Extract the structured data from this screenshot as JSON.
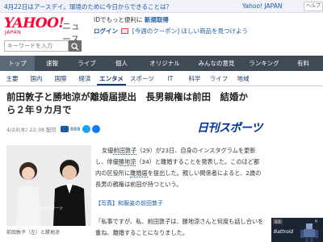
{
  "infobar": {
    "promo": "4月22日はアースデイ。環境のために今日からできることは？",
    "yahoo_japan": "Yahoo! JAPAN",
    "help": "ヘルプ"
  },
  "header": {
    "logo_main": "YAHOO!",
    "logo_sub": "JAPAN",
    "logo_news": "ニュース",
    "promo_line1": "IDでもっと便利に",
    "register": "新規取得",
    "login": "ログイン",
    "coupon": "[今週のクーポン] ほしい商品を見つけよう"
  },
  "search": {
    "placeholder": "キーワードを入力"
  },
  "nav_primary": [
    {
      "label": "トップ",
      "active": true
    },
    {
      "label": "速報"
    },
    {
      "label": "ライブ"
    },
    {
      "label": "個人"
    },
    {
      "label": "オリジナル"
    },
    {
      "label": "みんなの意見"
    },
    {
      "label": "ランキング"
    },
    {
      "label": "有料"
    }
  ],
  "nav_secondary": [
    {
      "label": "主要"
    },
    {
      "label": "国内"
    },
    {
      "label": "国際"
    },
    {
      "label": "経済"
    },
    {
      "label": "エンタメ",
      "active": true
    },
    {
      "label": "スポーツ"
    },
    {
      "label": "IT"
    },
    {
      "label": "科学"
    },
    {
      "label": "ライフ"
    },
    {
      "label": "地域"
    }
  ],
  "article": {
    "title": "前田敦子と勝地涼が離婚届提出　長男親権は前田　結婚から２年９カ月で",
    "date": "4/23(木) 22:38 配信",
    "comment_count": "888",
    "brand": "日刊スポーツ",
    "photo_caption": "前田敦子（左）と勝地涼",
    "photo_watermark": "日刊スポーツ",
    "body_prefix": "女優",
    "body_name1": "前田敦子",
    "body_mid1": "（29）が23日、自身のインスタグラムを更新し、俳優",
    "body_name2": "勝地涼",
    "body_mid2": "（34）と離婚することを発表した。このほど都内の区役所に",
    "body_term": "離婚届",
    "body_suffix": "を提出した。親しい関係者によると、2歳の長男の親権は前田が持つという。",
    "photo_link": "【写真】和服姿の前田敦子",
    "quote": "「私事ですが、私、前田敦子は、勝地涼さんと何度も話し合いを重ね、離婚することになりました。"
  },
  "ad": {
    "label": "広告",
    "title": "Battroid",
    "close": "×"
  },
  "colors": {
    "nav_bg": "#3f4a54",
    "link": "#1a5aa8",
    "yahoo_red": "#ff0033",
    "brand_blue": "#0030a0"
  }
}
